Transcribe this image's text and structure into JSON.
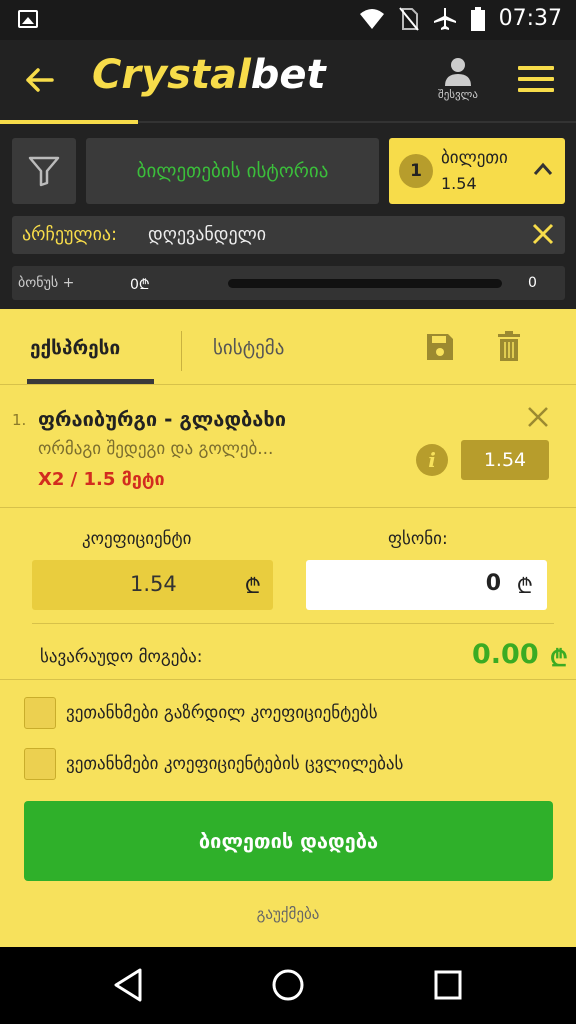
{
  "status_bar": {
    "time": "07:37"
  },
  "header": {
    "logo_part1": "Crystal",
    "logo_part2": "bet",
    "account_label": "შესვლა"
  },
  "toolbar": {
    "history_label": "ბილეთების ისტორია",
    "ticket": {
      "count": "1",
      "label": "ბილეთი",
      "odds": "1.54"
    },
    "filter": {
      "key": "არჩეულია:",
      "value": "დღევანდელი"
    },
    "bonus": {
      "label": "ბონუს +",
      "value": "0₾",
      "max": "0",
      "progress": 0
    }
  },
  "panel": {
    "tabs": [
      {
        "label": "ექსპრესი",
        "active": true
      },
      {
        "label": "სისტემა",
        "active": false
      }
    ],
    "event": {
      "number": "1.",
      "title": "ფრაიბურგი - გლადბახი",
      "subtitle": "ორმაგი შედეგი და გოლებ...",
      "pick": "X2 / 1.5 მეტი",
      "odds": "1.54"
    },
    "stake": {
      "coef_label": "კოეფიციენტი",
      "coef_value": "1.54",
      "stake_label": "ფსონი:",
      "stake_value": "0",
      "currency": "₾",
      "win_label": "სავარაუდო მოგება:",
      "win_value": "0.00"
    },
    "agreements": [
      {
        "label": "ვეთანხმები გაზრდილ კოეფიციენტებს",
        "checked": false
      },
      {
        "label": "ვეთანხმები კოეფიციენტების ცვლილებას",
        "checked": false
      }
    ],
    "place_button": "ბილეთის დადება",
    "cancel": "გაუქმება"
  },
  "colors": {
    "accent": "#f7dc4a",
    "panel": "#f7e15c",
    "green": "#2fb02a",
    "red": "#d22c1f",
    "dark": "#222222"
  }
}
